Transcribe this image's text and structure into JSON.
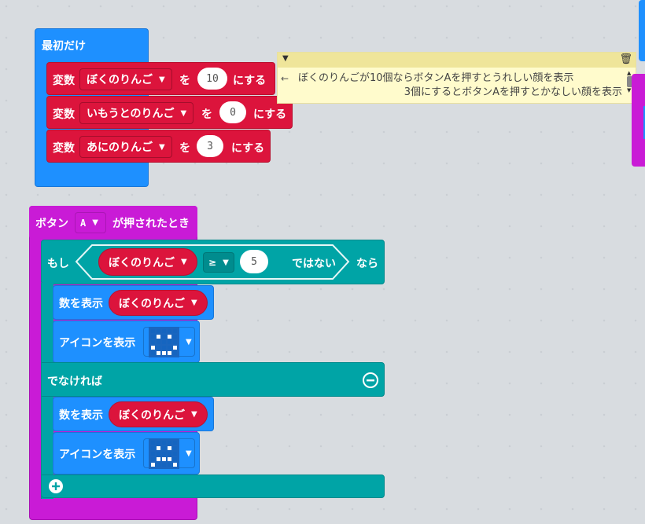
{
  "start_block": {
    "title": "最初だけ",
    "rows": [
      {
        "label_var": "変数",
        "var_name": "ぼくのりんご",
        "label_wo": "を",
        "value": "10",
        "label_set": "にする"
      },
      {
        "label_var": "変数",
        "var_name": "いもうとのりんご",
        "label_wo": "を",
        "value": "0",
        "label_set": "にする"
      },
      {
        "label_var": "変数",
        "var_name": "あにのりんご",
        "label_wo": "を",
        "value": "3",
        "label_set": "にする"
      }
    ]
  },
  "comment": {
    "collapse_icon": "triangle-down-icon",
    "delete_icon": "trash-icon",
    "arrow": "←",
    "line1": "ぼくのりんごが10個ならボタンAを押すとうれしい顔を表示",
    "line2": "3個にするとボタンAを押すとかなしい顔を表示"
  },
  "button_event": {
    "label_button": "ボタン",
    "button_value": "A",
    "label_pressed": "が押されたとき"
  },
  "if_block": {
    "label_if": "もし",
    "var_name": "ぼくのりんご",
    "operator": "≥",
    "compare_value": "5",
    "label_not": "ではない",
    "label_then": "なら",
    "label_else": "でなければ",
    "remove_icon": "minus-circle-icon",
    "add_icon": "plus-circle-icon"
  },
  "then_actions": {
    "show_number_label": "数を表示",
    "show_number_var": "ぼくのりんご",
    "show_icon_label": "アイコンを表示",
    "icon": "happy-face-icon"
  },
  "else_actions": {
    "show_number_label": "数を表示",
    "show_number_var": "ぼくのりんご",
    "show_icon_label": "アイコンを表示",
    "icon": "sad-face-icon"
  },
  "colors": {
    "start_blue": "#1e90ff",
    "variable_red": "#dc143c",
    "input_magenta": "#c91bd6",
    "logic_teal": "#00a4a6",
    "comment_yellow": "#fffbcc"
  }
}
